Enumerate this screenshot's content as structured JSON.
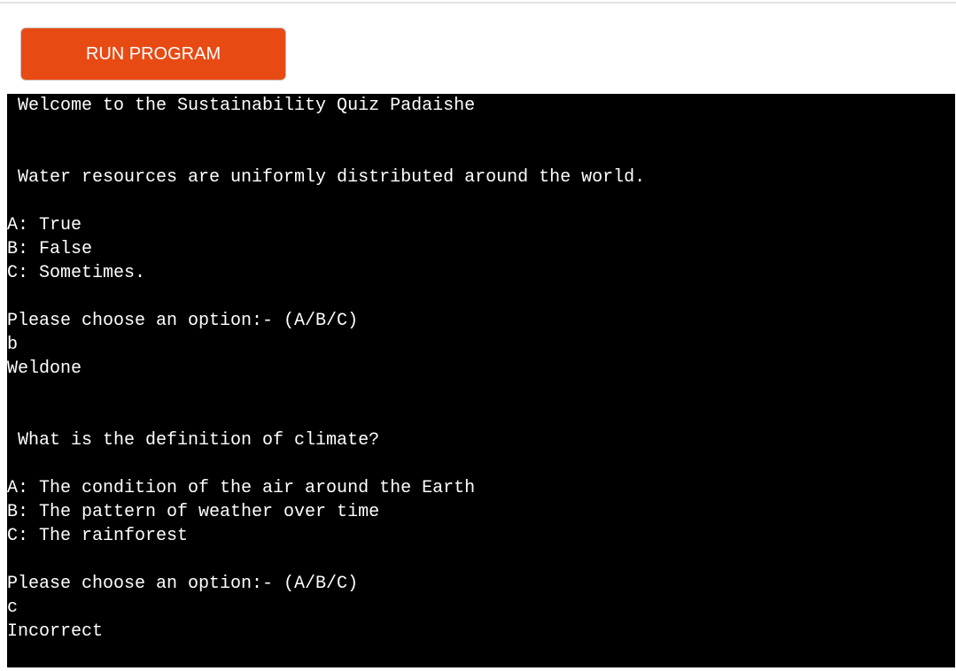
{
  "toolbar": {
    "run_label": "RUN PROGRAM"
  },
  "colors": {
    "accent": "#e84a14",
    "terminal_bg": "#000000",
    "terminal_fg": "#ffffff"
  },
  "terminal": {
    "lines": [
      " Welcome to the Sustainability Quiz Padaishe",
      "",
      "",
      " Water resources are uniformly distributed around the world.",
      "",
      "A: True",
      "B: False",
      "C: Sometimes.",
      "",
      "Please choose an option:- (A/B/C)",
      "b",
      "Weldone",
      "",
      "",
      " What is the definition of climate?",
      "",
      "A: The condition of the air around the Earth",
      "B: The pattern of weather over time",
      "C: The rainforest",
      "",
      "Please choose an option:- (A/B/C)",
      "c",
      "Incorrect"
    ]
  }
}
